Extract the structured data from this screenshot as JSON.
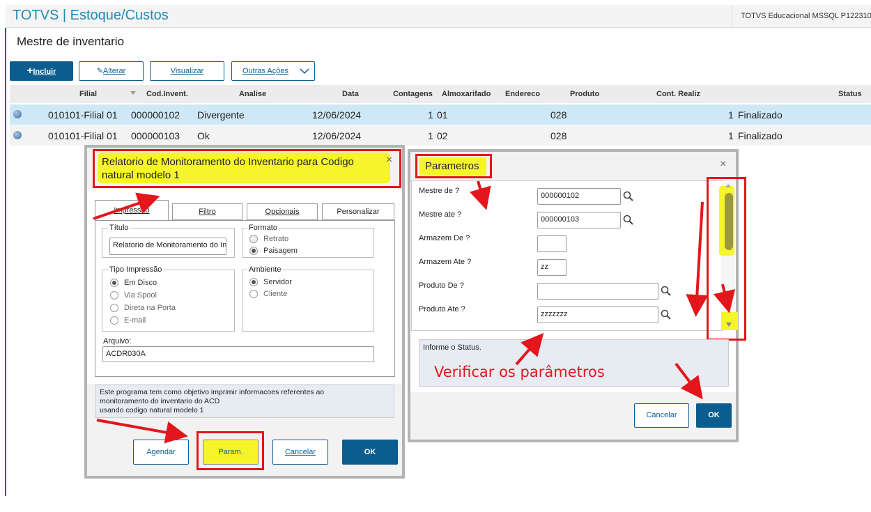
{
  "app": {
    "title": "TOTVS | Estoque/Custos",
    "server": "TOTVS Educacional MSSQL P122310"
  },
  "page": {
    "title": "Mestre de inventario"
  },
  "toolbar": {
    "incluir": "Incluir",
    "alterar": "Alterar",
    "visualizar": "Visualizar",
    "outras": "Outras Ações"
  },
  "grid": {
    "headers": [
      "Filial",
      "Cod.Invent.",
      "Analise",
      "Data",
      "Contagens",
      "Almoxarifado",
      "Endereco",
      "Produto",
      "Cont. Realiz",
      "Status"
    ],
    "rows": [
      {
        "filial": "010101-Filial 01",
        "cod": "000000102",
        "analise": "Divergente",
        "data": "12/06/2024",
        "contagens": "1",
        "almox": "01",
        "produto": "028",
        "cont": "1",
        "status": "Finalizado"
      },
      {
        "filial": "010101-Filial 01",
        "cod": "000000103",
        "analise": "Ok",
        "data": "12/06/2024",
        "contagens": "1",
        "almox": "02",
        "produto": "028",
        "cont": "1",
        "status": "Finalizado"
      }
    ]
  },
  "report": {
    "title": "Relatorio de Monitoramento do Inventario para Codigo natural modelo 1",
    "tabs": [
      "Impressão",
      "Filtro",
      "Opcionais",
      "Personalizar"
    ],
    "titulo_label": "Título",
    "titulo_value": "Relatorio de Monitoramento do Inventario",
    "formato_label": "Formato",
    "formato_options": [
      "Retrato",
      "Paisagem"
    ],
    "tipo_label": "Tipo Impressão",
    "tipo_options": [
      "Em Disco",
      "Via Spool",
      "Direta na Porta",
      "E-mail"
    ],
    "ambiente_label": "Ambiente",
    "ambiente_options": [
      "Servidor",
      "Cliente"
    ],
    "arquivo_label": "Arquivo:",
    "arquivo_value": "ACDR030A",
    "desc_line1": "Este programa tem como objetivo imprimir informacoes referentes ao",
    "desc_line2": "monitoramento do inventario do ACD",
    "desc_line3": "usando codigo natural modelo 1",
    "buttons": {
      "agendar": "Agendar",
      "param": "Param.",
      "cancelar": "Cancelar",
      "ok": "OK"
    }
  },
  "params": {
    "title": "Parametros",
    "fields": [
      {
        "label": "Mestre de ?",
        "value": "000000102"
      },
      {
        "label": "Mestre ate ?",
        "value": "000000103"
      },
      {
        "label": "Armazem De ?",
        "value": ""
      },
      {
        "label": "Armazem Ate ?",
        "value": "zz"
      },
      {
        "label": "Produto De ?",
        "value": ""
      },
      {
        "label": "Produto Ate ?",
        "value": "zzzzzzz"
      }
    ],
    "help": "Informe o Status.",
    "buttons": {
      "cancelar": "Cancelar",
      "ok": "OK"
    }
  },
  "annotation": {
    "text": "Verificar os parâmetros",
    "color": "#e3161c",
    "highlight": "#f5f52a"
  }
}
